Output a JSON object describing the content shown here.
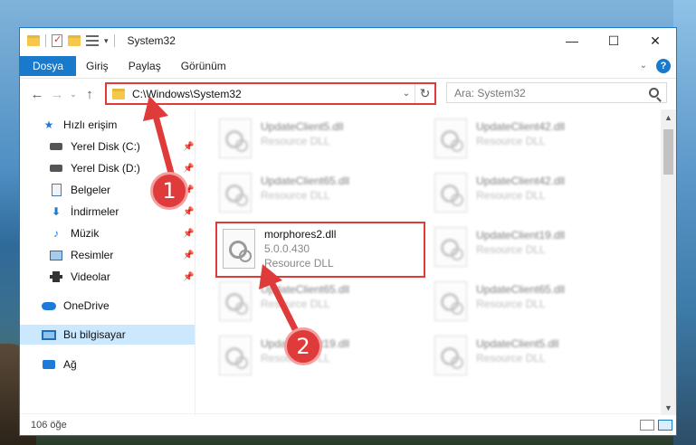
{
  "window": {
    "title": "System32",
    "minimize": "—",
    "maximize": "☐",
    "close": "✕"
  },
  "ribbon": {
    "tabs": [
      "Dosya",
      "Giriş",
      "Paylaş",
      "Görünüm"
    ],
    "collapse": "⌄",
    "help": "?"
  },
  "address": {
    "back": "←",
    "forward": "→",
    "recent": "⌄",
    "up": "↑",
    "path": "C:\\Windows\\System32",
    "dropdown": "⌄",
    "refresh": "↻"
  },
  "search": {
    "placeholder": "Ara: System32"
  },
  "nav": {
    "items": [
      {
        "label": "Hızlı erişim",
        "icon": "star-icon"
      },
      {
        "label": "Yerel Disk (C:)",
        "icon": "drive-icon",
        "pinned": true
      },
      {
        "label": "Yerel Disk (D:)",
        "icon": "drive-icon",
        "pinned": true
      },
      {
        "label": "Belgeler",
        "icon": "document-icon",
        "pinned": true
      },
      {
        "label": "İndirmeler",
        "icon": "download-icon",
        "pinned": true
      },
      {
        "label": "Müzik",
        "icon": "music-icon",
        "pinned": true
      },
      {
        "label": "Resimler",
        "icon": "pictures-icon",
        "pinned": true
      },
      {
        "label": "Videolar",
        "icon": "video-icon",
        "pinned": true
      },
      {
        "label": "OneDrive",
        "icon": "onedrive-icon"
      },
      {
        "label": "Bu bilgisayar",
        "icon": "this-pc-icon",
        "selected": true
      },
      {
        "label": "Ağ",
        "icon": "network-icon"
      }
    ],
    "pin_glyph": "📌"
  },
  "files": [
    {
      "name": "UpdateClient5.dll",
      "type": "Resource DLL",
      "blurred": true
    },
    {
      "name": "UpdateClient42.dll",
      "type": "Resource DLL",
      "blurred": true
    },
    {
      "name": "UpdateClient65.dll",
      "type": "Resource DLL",
      "blurred": true
    },
    {
      "name": "UpdateClient42.dll",
      "type": "Resource DLL",
      "blurred": true
    },
    {
      "name": "morphores2.dll",
      "version": "5.0.0.430",
      "type": "Resource DLL",
      "highlighted": true
    },
    {
      "name": "UpdateClient19.dll",
      "type": "Resource DLL",
      "blurred": true
    },
    {
      "name": "UpdateClient65.dll",
      "type": "Resource DLL",
      "blurred": true
    },
    {
      "name": "UpdateClient65.dll",
      "type": "Resource DLL",
      "blurred": true
    },
    {
      "name": "UpdateClient19.dll",
      "type": "Resource DLL",
      "blurred": true
    },
    {
      "name": "UpdateClient5.dll",
      "type": "Resource DLL",
      "blurred": true
    }
  ],
  "status": {
    "count": "106 öğe"
  },
  "annotations": {
    "badge1": "1",
    "badge2": "2",
    "color": "#e03b3b"
  }
}
